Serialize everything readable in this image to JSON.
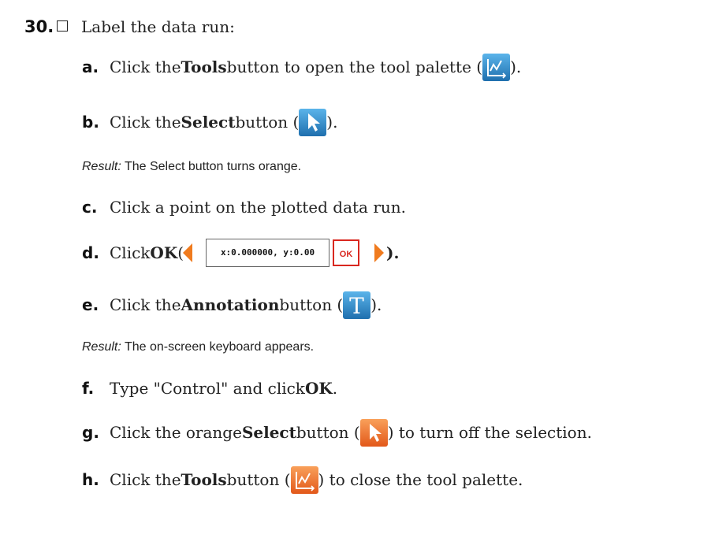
{
  "step": {
    "number": "30.",
    "intro": "Label the data run:"
  },
  "colors": {
    "accent_orange": "#f07b1e",
    "ok_red": "#d9271f",
    "blue_icon": "#2e86c9"
  },
  "steps": {
    "a": {
      "letter": "a.",
      "pre": "Click the ",
      "bold": "Tools",
      "post": " button to open the tool palette (",
      "end": ").",
      "icon": "graph-tools-icon"
    },
    "b": {
      "letter": "b.",
      "pre": "Click the ",
      "bold": "Select",
      "post": " button (",
      "end": ").",
      "icon": "select-arrow-icon"
    },
    "b_result": {
      "label": "Result:",
      "text": " The Select button turns orange."
    },
    "c": {
      "letter": "c.",
      "text": "Click a point on the plotted data run."
    },
    "d": {
      "letter": "d.",
      "pre": "Click ",
      "bold": "OK",
      "post": " (",
      "end": ").",
      "readout": "x:0.000000, y:0.00",
      "ok": "OK"
    },
    "e": {
      "letter": "e.",
      "pre": "Click the ",
      "bold": "Annotation",
      "post": " button (",
      "end": ").",
      "icon": "annotation-t-icon"
    },
    "e_result": {
      "label": "Result:",
      "text": " The on-screen keyboard appears."
    },
    "f": {
      "letter": "f.",
      "pre": "Type \"Control\" and click ",
      "bold": "OK",
      "end": "."
    },
    "g": {
      "letter": "g.",
      "pre": "Click the orange ",
      "bold": "Select",
      "post": " button (",
      "end": ") to turn off the selection.",
      "icon": "select-arrow-orange-icon"
    },
    "h": {
      "letter": "h.",
      "pre": "Click the ",
      "bold": "Tools",
      "post": " button (",
      "end": ") to close the tool palette.",
      "icon": "graph-tools-orange-icon"
    }
  }
}
